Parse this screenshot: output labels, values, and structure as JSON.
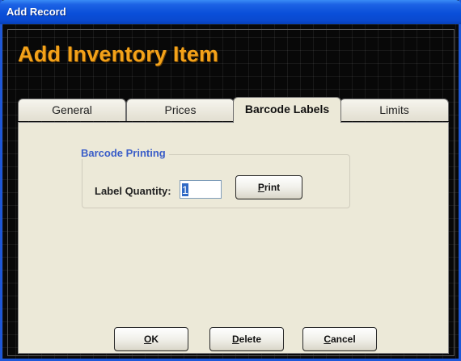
{
  "window": {
    "title": "Add Record"
  },
  "header": {
    "title": "Add Inventory Item"
  },
  "tabs": [
    {
      "label": "General",
      "active": false
    },
    {
      "label": "Prices",
      "active": false
    },
    {
      "label": "Barcode Labels",
      "active": true
    },
    {
      "label": "Limits",
      "active": false
    }
  ],
  "barcode_printing": {
    "group_label": "Barcode Printing",
    "quantity_label": "Label Quantity:",
    "quantity_value": "1",
    "print_button": {
      "mnemonic": "P",
      "rest": "rint"
    }
  },
  "footer": {
    "ok_button": {
      "mnemonic": "O",
      "rest": "K"
    },
    "delete_button": {
      "mnemonic": "D",
      "rest": "elete"
    },
    "cancel_button": {
      "mnemonic": "C",
      "rest": "ancel"
    }
  },
  "colors": {
    "title_bar": "#0a4fd9",
    "header_title": "#f3a21a",
    "group_label": "#3a5dc8",
    "panel_bg": "#ece9d8",
    "background": "#080808"
  }
}
